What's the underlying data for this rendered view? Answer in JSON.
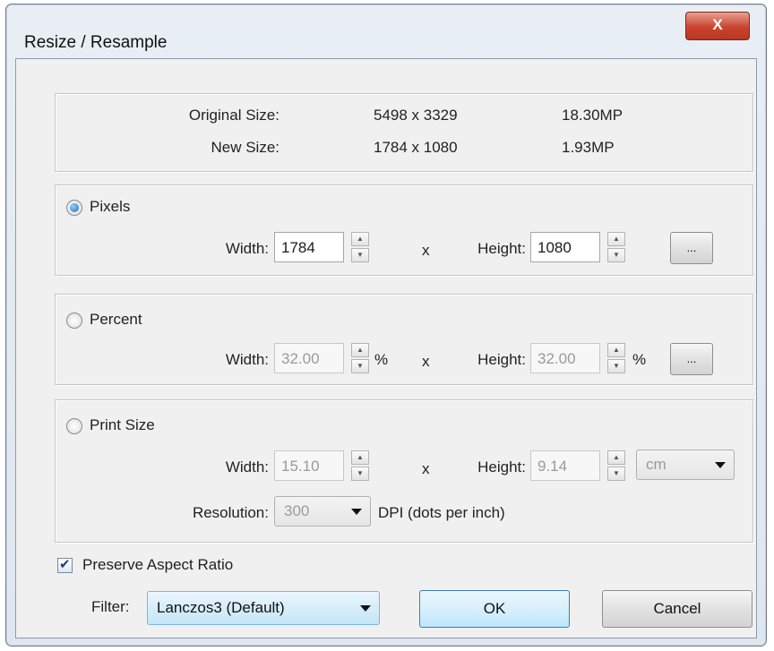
{
  "window": {
    "title": "Resize / Resample",
    "close_label": "X"
  },
  "info": {
    "original_label": "Original Size:",
    "original_dims": "5498 x 3329",
    "original_mp": "18.30MP",
    "new_label": "New Size:",
    "new_dims": "1784 x 1080",
    "new_mp": "1.93MP"
  },
  "pixels": {
    "label": "Pixels",
    "selected": true,
    "width_label": "Width:",
    "width": "1784",
    "x": "x",
    "height_label": "Height:",
    "height": "1080",
    "more_label": "..."
  },
  "percent": {
    "label": "Percent",
    "selected": false,
    "width_label": "Width:",
    "width": "32.00",
    "unit1": "%",
    "x": "x",
    "height_label": "Height:",
    "height": "32.00",
    "unit2": "%",
    "more_label": "..."
  },
  "print": {
    "label": "Print Size",
    "selected": false,
    "width_label": "Width:",
    "width": "15.10",
    "x": "x",
    "height_label": "Height:",
    "height": "9.14",
    "unit": "cm",
    "resolution_label": "Resolution:",
    "resolution": "300",
    "dpi_label": "DPI (dots per inch)"
  },
  "aspect": {
    "label": "Preserve Aspect Ratio",
    "checked": true
  },
  "filter": {
    "label": "Filter:",
    "value": "Lanczos3 (Default)"
  },
  "buttons": {
    "ok": "OK",
    "cancel": "Cancel"
  },
  "colors": {
    "accent": "#3c7fb1",
    "close": "#c9442d"
  }
}
